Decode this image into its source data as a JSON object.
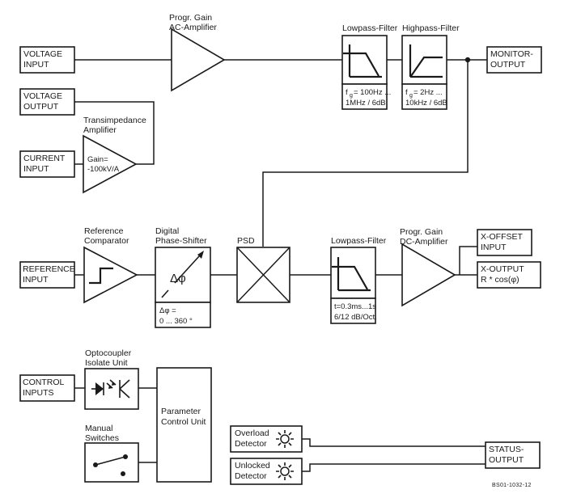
{
  "figure": {
    "id_code": "BS01-1032-12",
    "ink_color": "#1a1a1a",
    "background": "#ffffff"
  },
  "signal_path": {
    "voltage_input": {
      "line1": "VOLTAGE",
      "line2": "INPUT"
    },
    "voltage_output": {
      "line1": "VOLTAGE",
      "line2": "OUTPUT"
    },
    "current_input": {
      "line1": "CURRENT",
      "line2": "INPUT"
    },
    "transimpedance": {
      "caption1": "Transimpedance",
      "caption2": "Amplifier",
      "gain1": "Gain=",
      "gain2": "-100kV/A"
    },
    "ac_amplifier": {
      "caption1": "Progr. Gain",
      "caption2": "AC-Amplifier"
    },
    "lowpass1": {
      "caption": "Lowpass-Filter",
      "spec_prefix": "f",
      "spec_sub": "g",
      "spec1": "= 100Hz ...",
      "spec2": "1MHz / 6dB"
    },
    "highpass": {
      "caption": "Highpass-Filter",
      "spec_prefix": "f",
      "spec_sub": "g",
      "spec1": "= 2Hz ...",
      "spec2": "10kHz / 6dB"
    },
    "monitor_output": {
      "line1": "MONITOR-",
      "line2": "OUTPUT"
    }
  },
  "reference_path": {
    "reference_input": {
      "line1": "REFERENCE",
      "line2": "INPUT"
    },
    "comparator": {
      "caption1": "Reference",
      "caption2": "Comparator"
    },
    "phase_shifter": {
      "caption1": "Digital",
      "caption2": "Phase-Shifter",
      "glyph": "Δφ",
      "spec1": "Δφ =",
      "spec2": "0 ... 360 °"
    },
    "psd": {
      "label": "PSD"
    },
    "lowpass2": {
      "caption": "Lowpass-Filter",
      "spec1": "t=0.3ms...1s",
      "spec2": "6/12 dB/Oct."
    },
    "dc_amplifier": {
      "caption1": "Progr. Gain",
      "caption2": "DC-Amplifier"
    },
    "x_offset_input": {
      "line1": "X-OFFSET",
      "line2": "INPUT"
    },
    "x_output": {
      "line1": "X-OUTPUT",
      "line2": "R * cos(φ)"
    }
  },
  "control_path": {
    "control_inputs": {
      "line1": "CONTROL",
      "line2": "INPUTS"
    },
    "optocoupler": {
      "caption1": "Optocoupler",
      "caption2": "Isolate Unit"
    },
    "manual_switches": {
      "caption1": "Manual",
      "caption2": "Switches"
    },
    "parameter_control_unit": {
      "line1": "Parameter",
      "line2": "Control Unit"
    },
    "overload_detector": {
      "line1": "Overload",
      "line2": "Detector"
    },
    "unlocked_detector": {
      "line1": "Unlocked",
      "line2": "Detector"
    },
    "status_output": {
      "line1": "STATUS-",
      "line2": "OUTPUT"
    }
  }
}
